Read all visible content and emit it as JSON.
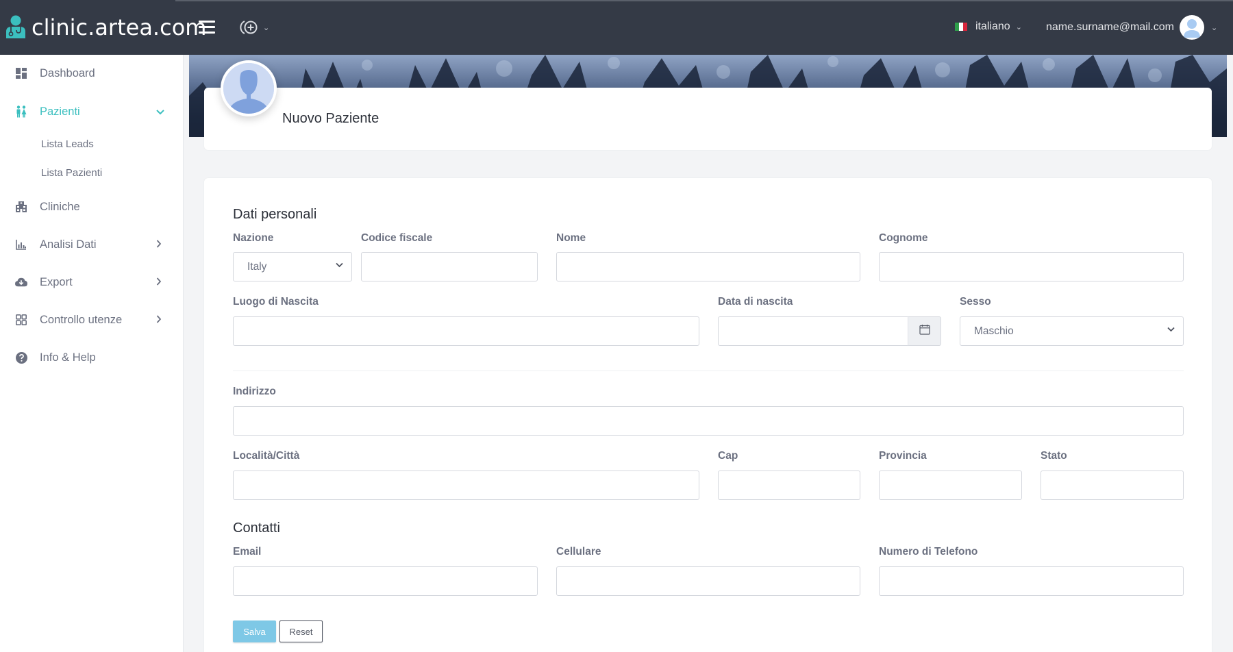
{
  "app": {
    "brand": "clinic.artea.com",
    "colors": {
      "topbar": "#343a46",
      "accent": "#3bbfbf",
      "save_button": "#7ec8e6",
      "sidebar_text": "#6b7080"
    }
  },
  "topbar": {
    "menu_icon": "hamburger-icon",
    "quick_add_icon": "add-circle-icon",
    "language": {
      "flag": "italy-flag",
      "label": "italiano"
    },
    "user": {
      "email": "name.surname@mail.com",
      "avatar_icon": "user-avatar-icon"
    }
  },
  "sidebar": {
    "items": [
      {
        "label": "Dashboard",
        "icon": "dashboard-icon",
        "has_arrow": false,
        "active": false
      },
      {
        "label": "Pazienti",
        "icon": "patients-icon",
        "has_arrow": true,
        "expanded": true,
        "active": true,
        "children": [
          {
            "label": "Lista Leads"
          },
          {
            "label": "Lista Pazienti"
          }
        ]
      },
      {
        "label": "Cliniche",
        "icon": "hospital-icon",
        "has_arrow": false,
        "active": false
      },
      {
        "label": "Analisi Dati",
        "icon": "chart-icon",
        "has_arrow": true,
        "active": false
      },
      {
        "label": "Export",
        "icon": "cloud-download-icon",
        "has_arrow": true,
        "active": false
      },
      {
        "label": "Controllo utenze",
        "icon": "grid-icon",
        "has_arrow": true,
        "active": false
      },
      {
        "label": "Info & Help",
        "icon": "help-icon",
        "has_arrow": false,
        "active": false
      }
    ]
  },
  "header": {
    "title": "Nuovo Paziente",
    "avatar_icon": "patient-placeholder-icon"
  },
  "form": {
    "personal": {
      "title": "Dati personali",
      "nazione": {
        "label": "Nazione",
        "value": "Italy"
      },
      "codice_fiscale": {
        "label": "Codice fiscale",
        "value": "",
        "placeholder": ""
      },
      "nome": {
        "label": "Nome",
        "value": "",
        "placeholder": ""
      },
      "cognome": {
        "label": "Cognome",
        "value": "",
        "placeholder": ""
      },
      "luogo_nascita": {
        "label": "Luogo di Nascita",
        "value": "",
        "placeholder": ""
      },
      "data_nascita": {
        "label": "Data di nascita",
        "value": "",
        "placeholder": ""
      },
      "sesso": {
        "label": "Sesso",
        "value": "Maschio"
      }
    },
    "address": {
      "indirizzo": {
        "label": "Indirizzo",
        "value": "",
        "placeholder": ""
      },
      "localita": {
        "label": "Località/Città",
        "value": "",
        "placeholder": ""
      },
      "cap": {
        "label": "Cap",
        "value": "",
        "placeholder": ""
      },
      "provincia": {
        "label": "Provincia",
        "value": "",
        "placeholder": ""
      },
      "stato": {
        "label": "Stato",
        "value": "",
        "placeholder": ""
      }
    },
    "contacts": {
      "title": "Contatti",
      "email": {
        "label": "Email",
        "value": "",
        "placeholder": ""
      },
      "cellulare": {
        "label": "Cellulare",
        "value": "",
        "placeholder": ""
      },
      "telefono": {
        "label": "Numero di Telefono",
        "value": "",
        "placeholder": ""
      }
    },
    "buttons": {
      "save": "Salva",
      "reset": "Reset"
    }
  }
}
